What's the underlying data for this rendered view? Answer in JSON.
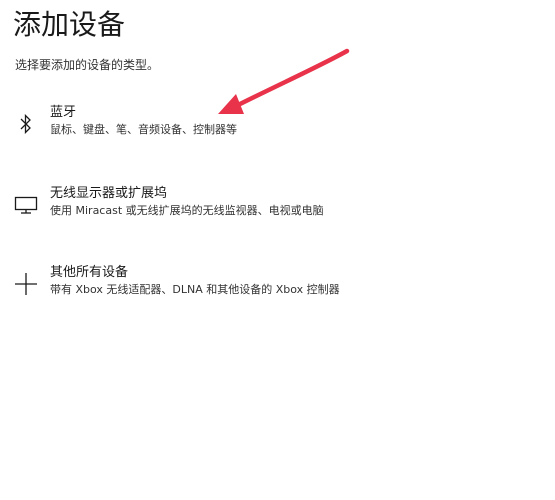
{
  "page": {
    "title": "添加设备",
    "subtitle": "选择要添加的设备的类型。"
  },
  "options": [
    {
      "icon": "bluetooth-icon",
      "name": "蓝牙",
      "description": "鼠标、键盘、笔、音频设备、控制器等"
    },
    {
      "icon": "monitor-icon",
      "name": "无线显示器或扩展坞",
      "description": "使用 Miracast 或无线扩展坞的无线监视器、电视或电脑"
    },
    {
      "icon": "plus-icon",
      "name": "其他所有设备",
      "description": "带有 Xbox 无线适配器、DLNA 和其他设备的 Xbox 控制器"
    }
  ],
  "colors": {
    "annotation_arrow": "#e8334a",
    "text_primary": "#1a1a1a",
    "text_secondary": "#333333"
  }
}
